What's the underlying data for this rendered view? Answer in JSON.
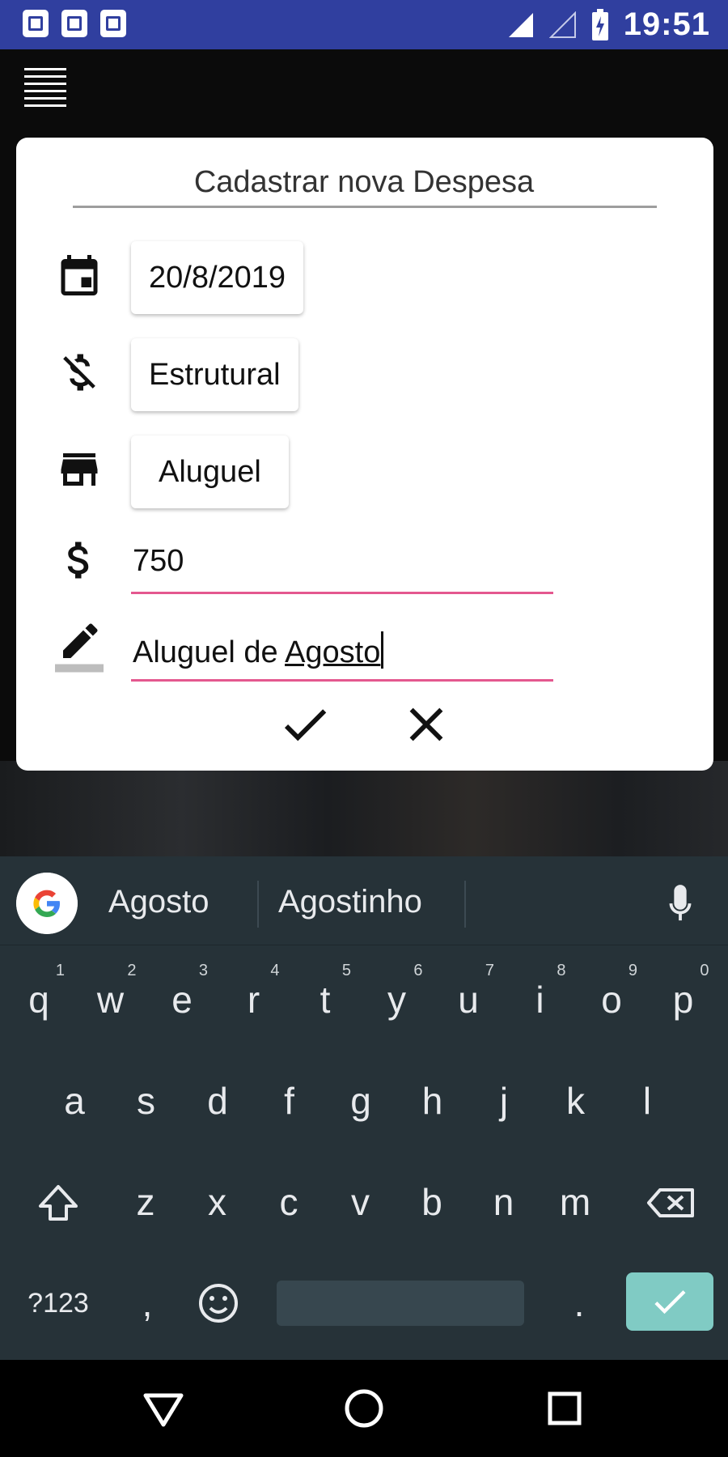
{
  "status_bar": {
    "time": "19:51",
    "icons": [
      "sim-card-icon",
      "image-icon",
      "photo-icon",
      "signal-icon",
      "signal-empty-icon",
      "battery-charging-icon"
    ]
  },
  "app": {
    "menu_icon": "menu-lines-icon"
  },
  "dialog": {
    "title": "Cadastrar nova Despesa",
    "date_value": "20/8/2019",
    "type_value": "Estrutural",
    "category_value": "Aluguel",
    "amount_value": "750",
    "description_prefix": "Aluguel de ",
    "description_word": "Agosto",
    "accent_color": "#e4588f",
    "confirm_icon": "check-icon",
    "cancel_icon": "close-icon"
  },
  "keyboard": {
    "suggestions": [
      "Agosto",
      "Agostinho"
    ],
    "row1": [
      {
        "k": "q",
        "n": "1"
      },
      {
        "k": "w",
        "n": "2"
      },
      {
        "k": "e",
        "n": "3"
      },
      {
        "k": "r",
        "n": "4"
      },
      {
        "k": "t",
        "n": "5"
      },
      {
        "k": "y",
        "n": "6"
      },
      {
        "k": "u",
        "n": "7"
      },
      {
        "k": "i",
        "n": "8"
      },
      {
        "k": "o",
        "n": "9"
      },
      {
        "k": "p",
        "n": "0"
      }
    ],
    "row2": [
      "a",
      "s",
      "d",
      "f",
      "g",
      "h",
      "j",
      "k",
      "l"
    ],
    "row3": [
      "z",
      "x",
      "c",
      "v",
      "b",
      "n",
      "m"
    ],
    "symbols_label": "?123",
    "comma": ",",
    "period": ".",
    "enter_color": "#80cbc4"
  },
  "nav_bar": {
    "buttons": [
      "back-triangle-icon",
      "home-circle-icon",
      "recents-square-icon"
    ]
  }
}
